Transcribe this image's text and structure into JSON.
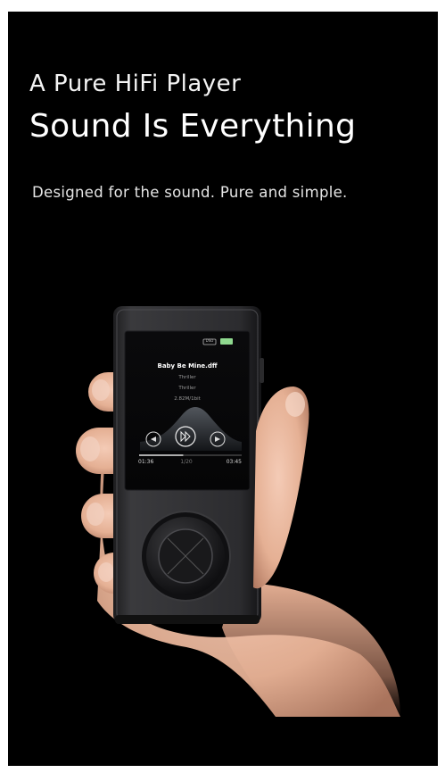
{
  "headline_small": "A Pure HiFi Player",
  "headline_large": "Sound Is Everything",
  "tagline": "Designed for the sound. Pure and simple.",
  "player_screen": {
    "track_title": "Baby Be Mine.dff",
    "artist": "Thriller",
    "album": "Thriller",
    "format": "2.82M/1bit",
    "elapsed": "01:36",
    "track_position": "1/20",
    "duration": "03:45",
    "battery_label": "DSD",
    "progress": 0.43
  },
  "colors": {
    "background": "#000000",
    "text": "#ffffff",
    "device_body": "#2a2a2c",
    "skin": "#e9b9a0"
  }
}
